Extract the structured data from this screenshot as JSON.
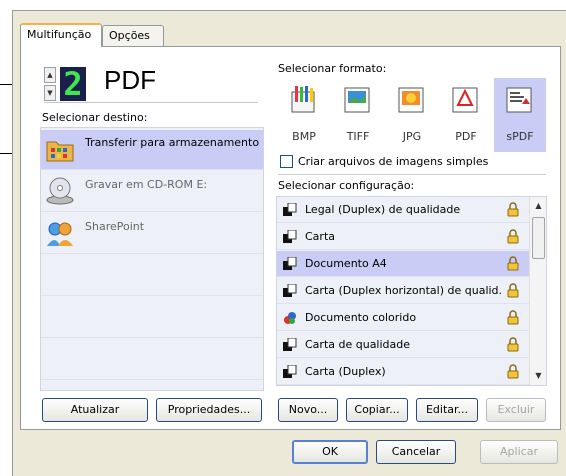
{
  "tabs": [
    {
      "label": "Multifunção"
    },
    {
      "label": "Opções"
    }
  ],
  "counter": {
    "digit": "2",
    "label": "PDF"
  },
  "destination": {
    "heading": "Selecionar destino:",
    "items": [
      {
        "label": "Transferir para armazenamento",
        "icon": "storage-folder-icon",
        "selected": true
      },
      {
        "label": "Gravar em CD-ROM  E:",
        "icon": "cd-drive-icon",
        "selected": false
      },
      {
        "label": "SharePoint",
        "icon": "sharepoint-icon",
        "selected": false
      }
    ],
    "buttons": {
      "refresh": "Atualizar",
      "properties": "Propriedades..."
    }
  },
  "format": {
    "heading": "Selecionar formato:",
    "items": [
      {
        "label": "BMP",
        "icon": "bmp-icon"
      },
      {
        "label": "TIFF",
        "icon": "tiff-icon"
      },
      {
        "label": "JPG",
        "icon": "jpg-icon"
      },
      {
        "label": "PDF",
        "icon": "pdf-icon"
      },
      {
        "label": "sPDF",
        "icon": "spdf-icon",
        "selected": true
      }
    ],
    "single_image_checkbox": "Criar arquivos de imagens simples",
    "single_image_checked": false
  },
  "configuration": {
    "heading": "Selecionar configuração:",
    "items": [
      {
        "label": "Legal (Duplex) de qualidade"
      },
      {
        "label": "Carta"
      },
      {
        "label": "Documento A4",
        "selected": true
      },
      {
        "label": "Carta (Duplex horizontal) de qualid..."
      },
      {
        "label": "Documento colorido"
      },
      {
        "label": "Carta de qualidade"
      },
      {
        "label": "Carta (Duplex)"
      }
    ],
    "buttons": {
      "new": "Novo...",
      "copy": "Copiar...",
      "edit": "Editar...",
      "delete": "Excluir"
    }
  },
  "footer": {
    "ok": "OK",
    "cancel": "Cancelar",
    "apply": "Aplicar"
  },
  "colors": {
    "selection": "#c9cdf5",
    "counter_bg": "#1b1f4d",
    "counter_digit": "#3ee84a"
  }
}
